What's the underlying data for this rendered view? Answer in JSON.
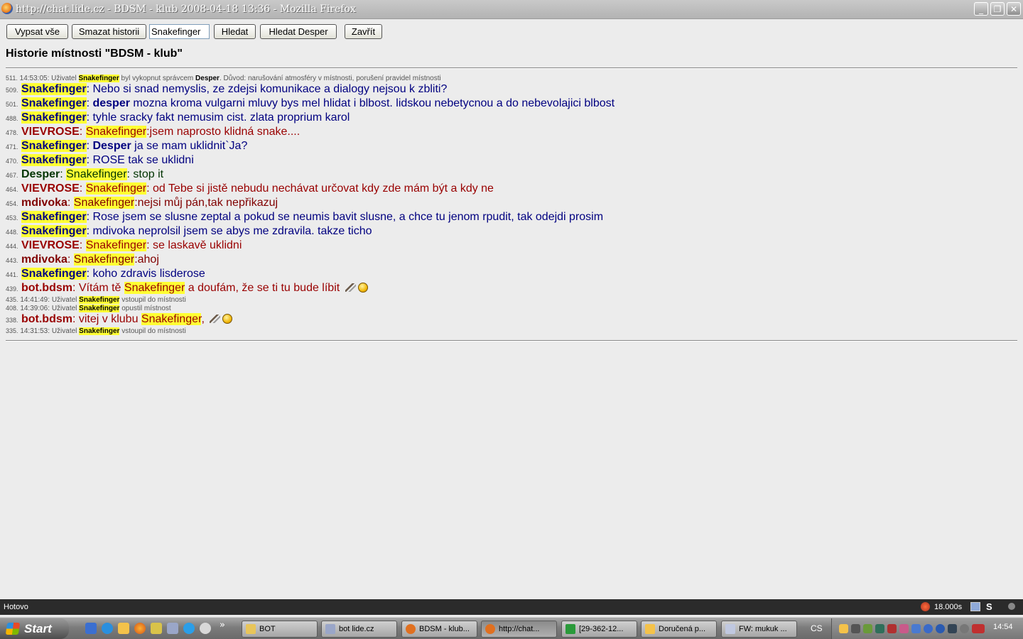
{
  "window": {
    "title": "http://chat.lide.cz - BDSM - klub 2008-04-18 13:36 - Mozilla Firefox",
    "minimize_glyph": "_",
    "restore_glyph": "❐",
    "close_glyph": "✕"
  },
  "toolbar": {
    "vypsat_vse": "Vypsat vše",
    "smazat_historii": "Smazat historii",
    "search_value": "Snakefinger",
    "hledat": "Hledat",
    "hledat_desper": "Hledat Desper",
    "zavrit": "Zavřít"
  },
  "heading": "Historie místnosti \"BDSM - klub\"",
  "colors": {
    "highlight": "#ffff33",
    "snakefinger_msg": "#000080",
    "vievrose": "#990000",
    "mdivoka": "#800000",
    "bot": "#990000",
    "desper": "#003300",
    "desper_nick_blue": "#000080"
  },
  "messages": [
    {
      "type": "system",
      "num": "511.",
      "time": "14:53:05:",
      "pre": "Uživatel",
      "user": "Snakefinger",
      "post": "byl vykopnut správcem",
      "by": "Desper",
      "tail": ". Důvod: narušování atmosféry v místnosti, porušení pravidel místnosti"
    },
    {
      "type": "msg",
      "num": "509.",
      "nick": "Snakefinger",
      "color": "#000080",
      "hl": true,
      "parts": [
        {
          "t": ": Nebo si snad nemyslis, ze zdejsi komunikace a dialogy nejsou k zbliti?"
        }
      ]
    },
    {
      "type": "msg",
      "num": "501.",
      "nick": "Snakefinger",
      "color": "#000080",
      "hl": true,
      "parts": [
        {
          "t": ": "
        },
        {
          "t": "desper",
          "bold": true
        },
        {
          "t": " mozna kroma vulgarni mluvy bys mel hlidat i blbost. lidskou nebetycnou a do nebevolajici blbost"
        }
      ]
    },
    {
      "type": "msg",
      "num": "488.",
      "nick": "Snakefinger",
      "color": "#000080",
      "hl": true,
      "parts": [
        {
          "t": ": tyhle sracky fakt nemusim cist. zlata proprium karol"
        }
      ]
    },
    {
      "type": "msg",
      "num": "478.",
      "nick": "VIEVROSE",
      "color": "#990000",
      "hl": false,
      "parts": [
        {
          "t": ": "
        },
        {
          "t": "Snakefinger",
          "hl": true
        },
        {
          "t": ":jsem naprosto klidná snake...."
        }
      ]
    },
    {
      "type": "msg",
      "num": "471.",
      "nick": "Snakefinger",
      "color": "#000080",
      "hl": true,
      "parts": [
        {
          "t": ": "
        },
        {
          "t": "Desper",
          "bold": true
        },
        {
          "t": " ja se mam uklidnit`Ja?"
        }
      ]
    },
    {
      "type": "msg",
      "num": "470.",
      "nick": "Snakefinger",
      "color": "#000080",
      "hl": true,
      "parts": [
        {
          "t": ": ROSE tak se uklidni"
        }
      ]
    },
    {
      "type": "msg",
      "num": "467.",
      "nick": "Desper",
      "color": "#003300",
      "hl": false,
      "parts": [
        {
          "t": ": "
        },
        {
          "t": "Snakefinger",
          "hl": true
        },
        {
          "t": ": stop it"
        }
      ]
    },
    {
      "type": "msg",
      "num": "464.",
      "nick": "VIEVROSE",
      "color": "#990000",
      "hl": false,
      "parts": [
        {
          "t": ": "
        },
        {
          "t": "Snakefinger",
          "hl": true
        },
        {
          "t": ": od Tebe si jistě nebudu nechávat určovat kdy zde mám být a kdy ne"
        }
      ]
    },
    {
      "type": "msg",
      "num": "454.",
      "nick": "mdivoka",
      "color": "#800000",
      "hl": false,
      "parts": [
        {
          "t": ": "
        },
        {
          "t": "Snakefinger",
          "hl": true
        },
        {
          "t": ":nejsi můj pán,tak nepřikazuj"
        }
      ]
    },
    {
      "type": "msg",
      "num": "453.",
      "nick": "Snakefinger",
      "color": "#000080",
      "hl": true,
      "parts": [
        {
          "t": ": Rose jsem se slusne zeptal a pokud se neumis bavit slusne, a chce tu jenom rpudit, tak odejdi prosim"
        }
      ]
    },
    {
      "type": "msg",
      "num": "448.",
      "nick": "Snakefinger",
      "color": "#000080",
      "hl": true,
      "parts": [
        {
          "t": ": mdivoka neprolsil jsem se abys me zdravila. takze ticho"
        }
      ]
    },
    {
      "type": "msg",
      "num": "444.",
      "nick": "VIEVROSE",
      "color": "#990000",
      "hl": false,
      "parts": [
        {
          "t": ": "
        },
        {
          "t": "Snakefinger",
          "hl": true
        },
        {
          "t": ": se laskavě uklidni"
        }
      ]
    },
    {
      "type": "msg",
      "num": "443.",
      "nick": "mdivoka",
      "color": "#800000",
      "hl": false,
      "parts": [
        {
          "t": ": "
        },
        {
          "t": "Snakefinger",
          "hl": true
        },
        {
          "t": ":ahoj"
        }
      ]
    },
    {
      "type": "msg",
      "num": "441.",
      "nick": "Snakefinger",
      "color": "#000080",
      "hl": true,
      "parts": [
        {
          "t": ": koho zdravis lisderose"
        }
      ]
    },
    {
      "type": "msg",
      "num": "439.",
      "nick": "bot.bdsm",
      "color": "#990000",
      "hl": false,
      "parts": [
        {
          "t": ": Vítám tě "
        },
        {
          "t": "Snakefinger",
          "hl": true
        },
        {
          "t": " a doufám, že se ti tu bude líbit "
        }
      ],
      "icons": [
        "whip-icon",
        "smiley-icon"
      ]
    },
    {
      "type": "system",
      "num": "435.",
      "time": "14:41:49:",
      "pre": "Uživatel",
      "user": "Snakefinger",
      "post": "vstoupil do místnosti"
    },
    {
      "type": "system",
      "num": "408.",
      "time": "14:39:06:",
      "pre": "Uživatel",
      "user": "Snakefinger",
      "post": "opustil místnost"
    },
    {
      "type": "msg",
      "num": "338.",
      "nick": "bot.bdsm",
      "color": "#990000",
      "hl": false,
      "parts": [
        {
          "t": ": vitej v klubu "
        },
        {
          "t": "Snakefinger",
          "hl": true
        },
        {
          "t": ", "
        }
      ],
      "icons": [
        "whip-icon",
        "smiley-icon"
      ]
    },
    {
      "type": "system",
      "num": "335.",
      "time": "14:31:53:",
      "pre": "Uživatel",
      "user": "Snakefinger",
      "post": "vstoupil do místnosti"
    }
  ],
  "statusbar": {
    "status": "Hotovo",
    "timer": "18.000s",
    "s_label": "S"
  },
  "taskbar": {
    "start": "Start",
    "more": "»",
    "tasks": [
      {
        "label": "BOT",
        "icon": "folder-icon"
      },
      {
        "label": "bot lide.cz",
        "icon": "document-icon"
      },
      {
        "label": "BDSM - klub...",
        "icon": "firefox-icon"
      },
      {
        "label": "http://chat...",
        "icon": "firefox-icon",
        "active": true
      },
      {
        "label": "[29-362-12...",
        "icon": "clover-icon"
      },
      {
        "label": "Doručená p...",
        "icon": "mail-icon"
      },
      {
        "label": "FW: mukuk ...",
        "icon": "mail-doc-icon"
      }
    ],
    "lang": "CS",
    "clock": "14:54"
  }
}
